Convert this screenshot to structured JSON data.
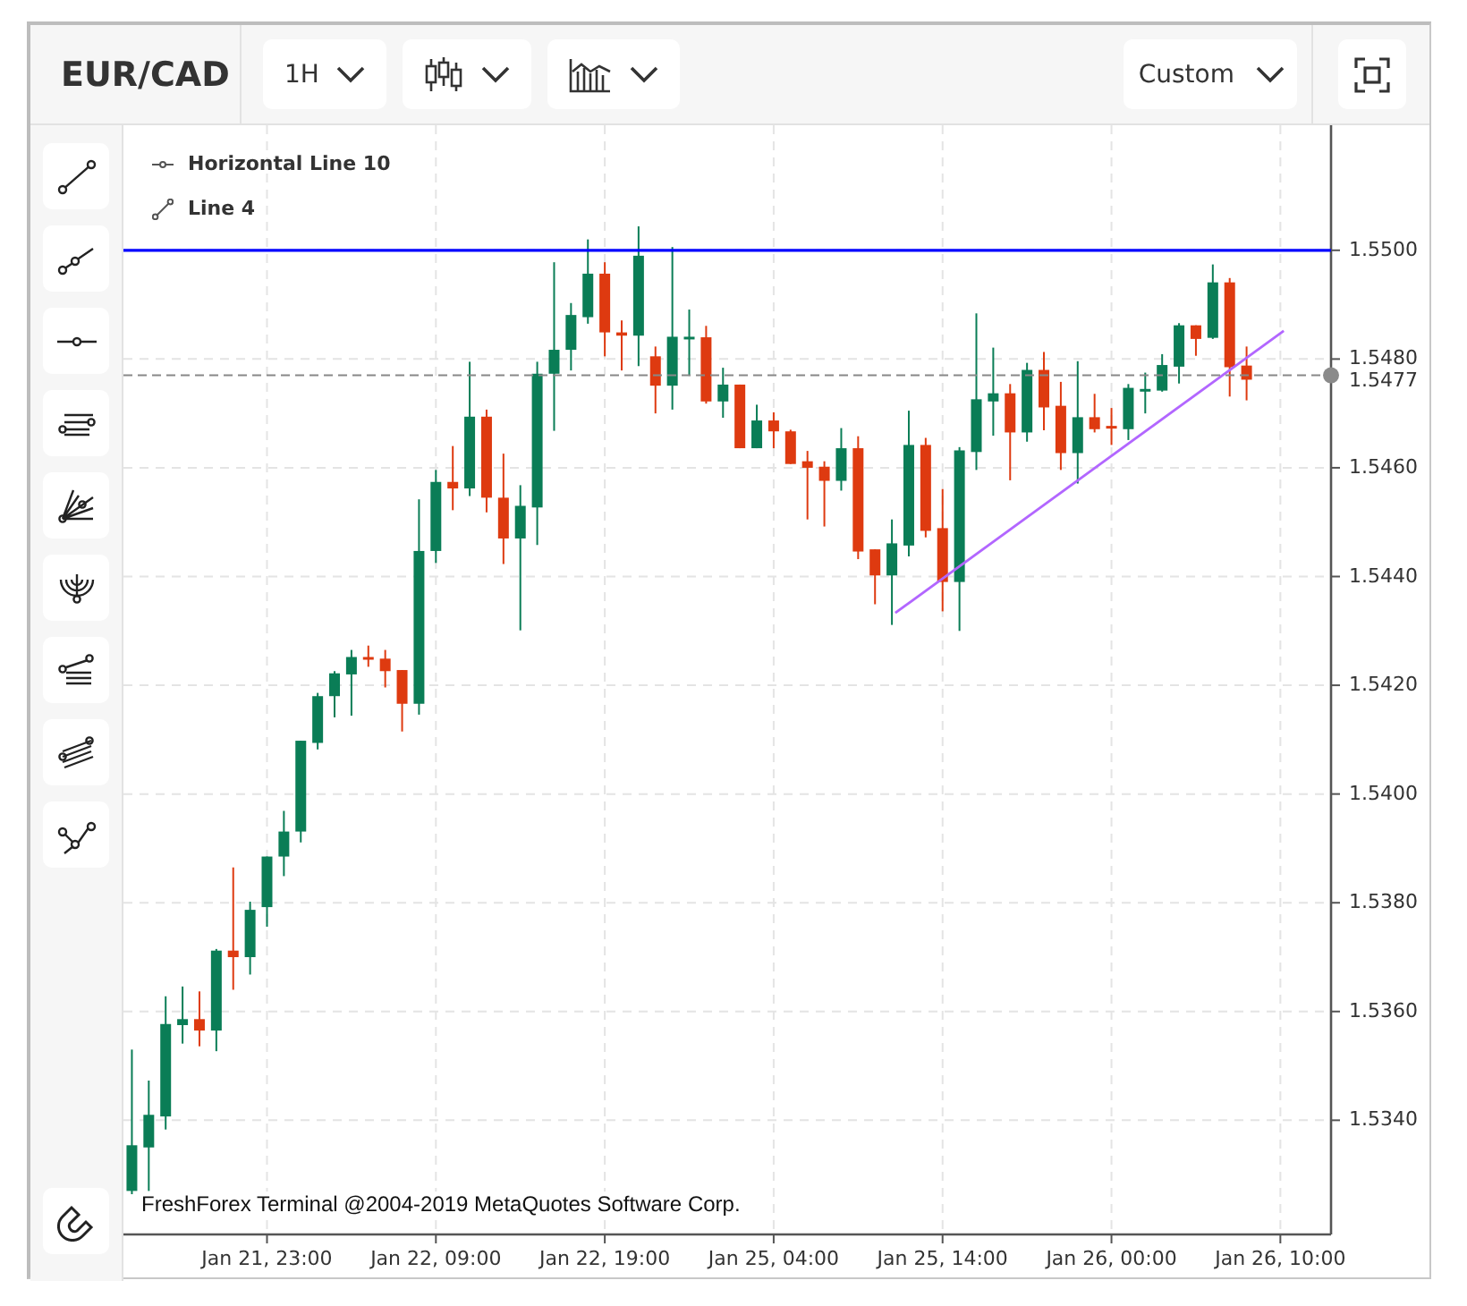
{
  "header": {
    "symbol": "EUR/CAD",
    "timeframe": "1H",
    "preset": "Custom"
  },
  "chart": {
    "chart_data": {
      "type": "candlestick",
      "ylim": [
        1.5319,
        1.5523
      ],
      "categories": [
        null,
        null,
        null,
        null,
        null,
        null,
        null,
        null,
        "Jan 21, 23:00",
        null,
        null,
        null,
        null,
        null,
        null,
        null,
        null,
        null,
        "Jan 22, 09:00",
        null,
        null,
        null,
        null,
        null,
        null,
        null,
        null,
        null,
        "Jan 22, 19:00",
        null,
        null,
        null,
        null,
        null,
        null,
        null,
        null,
        null,
        "Jan 25, 04:00",
        null,
        null,
        null,
        null,
        null,
        null,
        null,
        null,
        null,
        "Jan 25, 14:00",
        null,
        null,
        null,
        null,
        null,
        null,
        null,
        null,
        null,
        "Jan 26, 00:00",
        null,
        null,
        null,
        null,
        null,
        null,
        null,
        null,
        null,
        "Jan 26, 10:00"
      ],
      "yticks": [
        {
          "value": 1.534,
          "label": "1.5340"
        },
        {
          "value": 1.536,
          "label": "1.5360"
        },
        {
          "value": 1.538,
          "label": "1.5380"
        },
        {
          "value": 1.54,
          "label": "1.5400"
        },
        {
          "value": 1.542,
          "label": "1.5420"
        },
        {
          "value": 1.544,
          "label": "1.5440"
        },
        {
          "value": 1.546,
          "label": "1.5460"
        },
        {
          "value": 1.548,
          "label": "1.5480"
        },
        {
          "value": 1.55,
          "label": "1.5500"
        }
      ],
      "ohlc": [
        [
          1.5327,
          1.5353,
          1.53264,
          1.53354
        ],
        [
          1.5335,
          1.53473,
          1.5327,
          1.5341
        ],
        [
          1.53407,
          1.53628,
          1.53383,
          1.53577
        ],
        [
          1.53575,
          1.53646,
          1.53541,
          1.53586
        ],
        [
          1.53586,
          1.53637,
          1.53536,
          1.53565
        ],
        [
          1.53565,
          1.53715,
          1.53527,
          1.53712
        ],
        [
          1.53712,
          1.53865,
          1.5364,
          1.537
        ],
        [
          1.537,
          1.53802,
          1.53668,
          1.53787
        ],
        [
          1.53792,
          1.53885,
          1.53756,
          1.53885
        ],
        [
          1.53885,
          1.53969,
          1.53849,
          1.53931
        ],
        [
          1.53931,
          1.54098,
          1.53911,
          1.54098
        ],
        [
          1.54094,
          1.54186,
          1.54082,
          1.5418
        ],
        [
          1.5418,
          1.54226,
          1.54141,
          1.54222
        ],
        [
          1.5422,
          1.54265,
          1.54144,
          1.54252
        ],
        [
          1.54252,
          1.54273,
          1.54234,
          1.54247
        ],
        [
          1.54249,
          1.54265,
          1.54196,
          1.54226
        ],
        [
          1.54228,
          1.54228,
          1.54115,
          1.54166
        ],
        [
          1.54166,
          1.54542,
          1.54146,
          1.54447
        ],
        [
          1.54447,
          1.54596,
          1.54425,
          1.54574
        ],
        [
          1.54574,
          1.5464,
          1.54522,
          1.54562
        ],
        [
          1.54562,
          1.54795,
          1.54548,
          1.54694
        ],
        [
          1.54694,
          1.54707,
          1.54518,
          1.54545
        ],
        [
          1.54545,
          1.54626,
          1.54423,
          1.5447
        ],
        [
          1.5447,
          1.54568,
          1.54301,
          1.5453
        ],
        [
          1.54527,
          1.54795,
          1.54458,
          1.54773
        ],
        [
          1.54773,
          1.54978,
          1.54668,
          1.54817
        ],
        [
          1.54817,
          1.54903,
          1.54779,
          1.54881
        ],
        [
          1.54877,
          1.5502,
          1.54865,
          1.54957
        ],
        [
          1.54957,
          1.54978,
          1.54805,
          1.54849
        ],
        [
          1.54849,
          1.54871,
          1.54779,
          1.54843
        ],
        [
          1.54843,
          1.55044,
          1.54787,
          1.5499
        ],
        [
          1.54805,
          1.54823,
          1.547,
          1.54751
        ],
        [
          1.54751,
          1.55006,
          1.54707,
          1.54841
        ],
        [
          1.54837,
          1.54891,
          1.54769,
          1.54841
        ],
        [
          1.5484,
          1.54861,
          1.54718,
          1.54722
        ],
        [
          1.54722,
          1.54784,
          1.54692,
          1.54753
        ],
        [
          1.54753,
          1.54753,
          1.54636,
          1.54636
        ],
        [
          1.54636,
          1.54716,
          1.54636,
          1.54687
        ],
        [
          1.54687,
          1.54702,
          1.54636,
          1.54667
        ],
        [
          1.54667,
          1.5467,
          1.54607,
          1.54607
        ],
        [
          1.54612,
          1.54631,
          1.54505,
          1.546
        ],
        [
          1.54602,
          1.54612,
          1.54492,
          1.54576
        ],
        [
          1.54576,
          1.54673,
          1.54558,
          1.54636
        ],
        [
          1.54636,
          1.54658,
          1.54432,
          1.54446
        ],
        [
          1.5445,
          1.5445,
          1.54349,
          1.54402
        ],
        [
          1.54402,
          1.54505,
          1.54311,
          1.54461
        ],
        [
          1.54457,
          1.54705,
          1.54437,
          1.54642
        ],
        [
          1.54642,
          1.54655,
          1.54472,
          1.54484
        ],
        [
          1.54489,
          1.54561,
          1.54336,
          1.5439
        ],
        [
          1.5439,
          1.54638,
          1.543,
          1.54632
        ],
        [
          1.54629,
          1.54884,
          1.54596,
          1.54726
        ],
        [
          1.54722,
          1.54821,
          1.54659,
          1.54737
        ],
        [
          1.54737,
          1.54754,
          1.54577,
          1.54665
        ],
        [
          1.54665,
          1.54793,
          1.54648,
          1.5478
        ],
        [
          1.5478,
          1.54813,
          1.54669,
          1.54711
        ],
        [
          1.54714,
          1.54758,
          1.54596,
          1.54627
        ],
        [
          1.54627,
          1.54796,
          1.54571,
          1.54693
        ],
        [
          1.54693,
          1.54736,
          1.54665,
          1.54671
        ],
        [
          1.54677,
          1.5471,
          1.54642,
          1.54673
        ],
        [
          1.54671,
          1.54754,
          1.54651,
          1.54747
        ],
        [
          1.54742,
          1.54775,
          1.547,
          1.54745
        ],
        [
          1.54742,
          1.54809,
          1.5474,
          1.54789
        ],
        [
          1.54786,
          1.54866,
          1.54755,
          1.54862
        ],
        [
          1.54862,
          1.54862,
          1.54806,
          1.54837
        ],
        [
          1.54839,
          1.54974,
          1.54837,
          1.54941
        ],
        [
          1.54941,
          1.54949,
          1.54731,
          1.54785
        ],
        [
          1.54788,
          1.54823,
          1.54724,
          1.54762
        ],
        null,
        null
      ],
      "grid": true
    },
    "price_label": "1.5477"
  },
  "legend": [
    {
      "kind": "hline",
      "label": "Horizontal Line 10"
    },
    {
      "kind": "trend",
      "label": "Line 4"
    }
  ],
  "copyright": "FreshForex Terminal @2004-2019 MetaQuotes Software Corp."
}
